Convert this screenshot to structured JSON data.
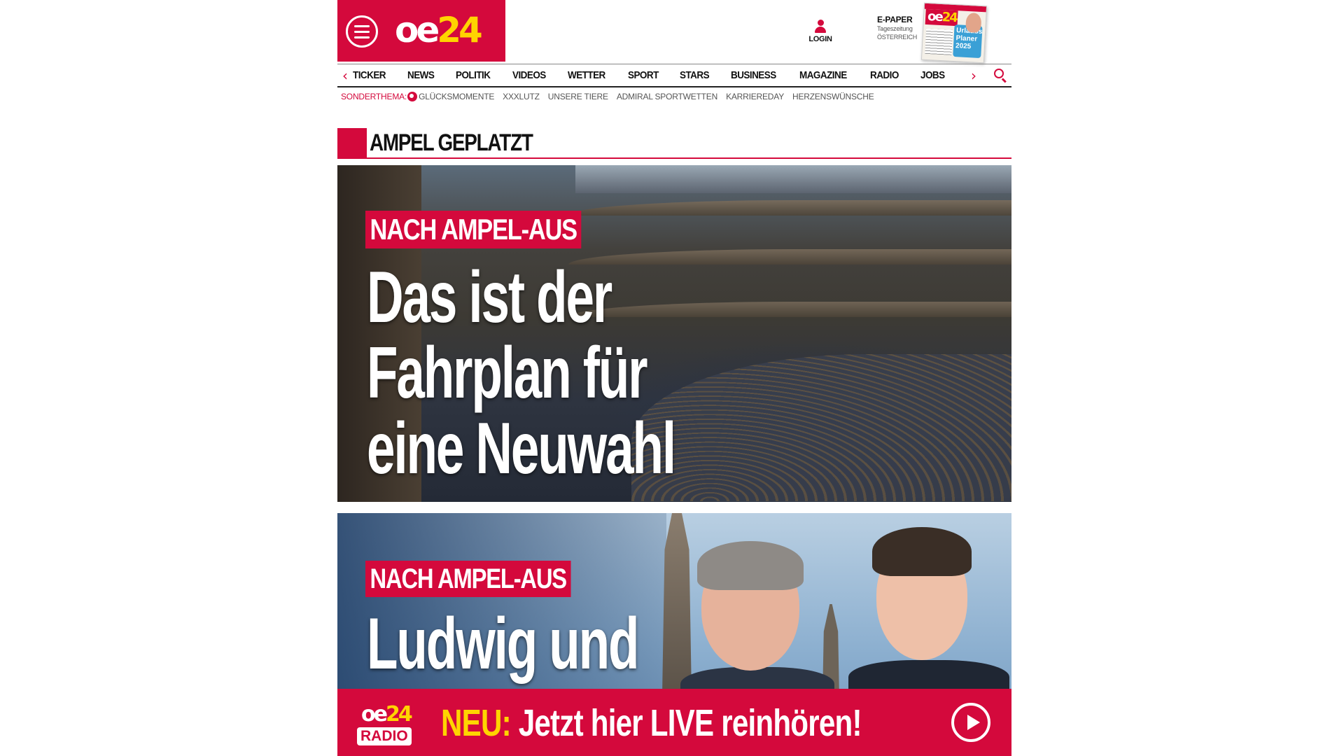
{
  "header": {
    "logo": {
      "oe": "oe",
      "num": "24"
    },
    "login_label": "LOGIN",
    "epaper": {
      "title": "E-PAPER",
      "line1": "Tageszeitung",
      "line2": "ÖSTERREICH"
    },
    "epaper_cover": {
      "logo_oe": "oe",
      "logo_num": "24",
      "promo": "Urlaubs Planer 2025"
    }
  },
  "nav": {
    "items": [
      "TICKER",
      "NEWS",
      "POLITIK",
      "VIDEOS",
      "WETTER",
      "SPORT",
      "STARS",
      "BUSINESS",
      "MAGAZINE",
      "RADIO",
      "JOBS"
    ]
  },
  "subnav": {
    "label": "SONDERTHEMA:",
    "items": [
      "GLÜCKSMOMENTE",
      "XXXLUTZ",
      "UNSERE TIERE",
      "ADMIRAL SPORTWETTEN",
      "KARRIEREDAY",
      "HERZENSWÜNSCHE"
    ]
  },
  "section": {
    "title": "AMPEL GEPLATZT"
  },
  "articles": [
    {
      "kicker": "NACH AMPEL-AUS",
      "headline": [
        "Das ist der",
        "Fahrplan für",
        "eine Neuwahl"
      ]
    },
    {
      "kicker": "NACH AMPEL-AUS",
      "headline": [
        "Ludwig und"
      ]
    }
  ],
  "radio_bar": {
    "logo_top_oe": "oe",
    "logo_top_num": "24",
    "logo_bottom": "RADIO",
    "highlight": "NEU:",
    "text": " Jetzt hier LIVE reinhören!"
  },
  "colors": {
    "brand_red": "#d4093c",
    "brand_yellow": "#ffd400"
  },
  "icons": [
    "menu-icon",
    "user-icon",
    "chevron-left-icon",
    "chevron-right-icon",
    "search-icon",
    "sonderthema-icon",
    "play-icon"
  ]
}
